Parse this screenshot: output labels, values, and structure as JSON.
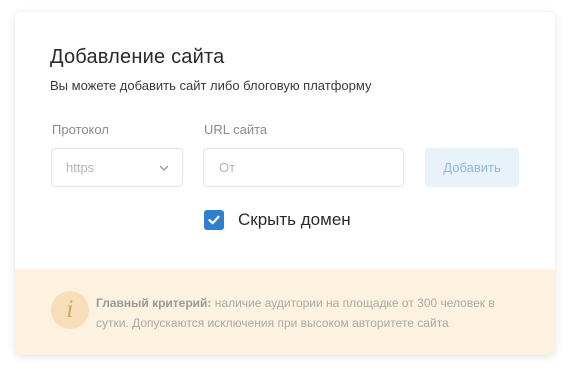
{
  "form": {
    "title": "Добавление сайта",
    "subtitle": "Вы можете добавить сайт либо блоговую платформу",
    "protocol_label": "Протокол",
    "protocol_value": "https",
    "url_label": "URL сайта",
    "url_placeholder": "От",
    "add_button": "Добавить",
    "hide_domain_label": "Скрыть домен",
    "hide_domain_checked": true
  },
  "notice": {
    "title": "Главный критерий:",
    "text": " наличие аудитории на площадке от 300 человек в сутки. Допускаются исключения при высоком авторитете сайта",
    "icon": "info-icon"
  },
  "colors": {
    "accent": "#2f7fcf",
    "button_bg": "#e8f2fb",
    "notice_bg": "#fdf2df"
  }
}
